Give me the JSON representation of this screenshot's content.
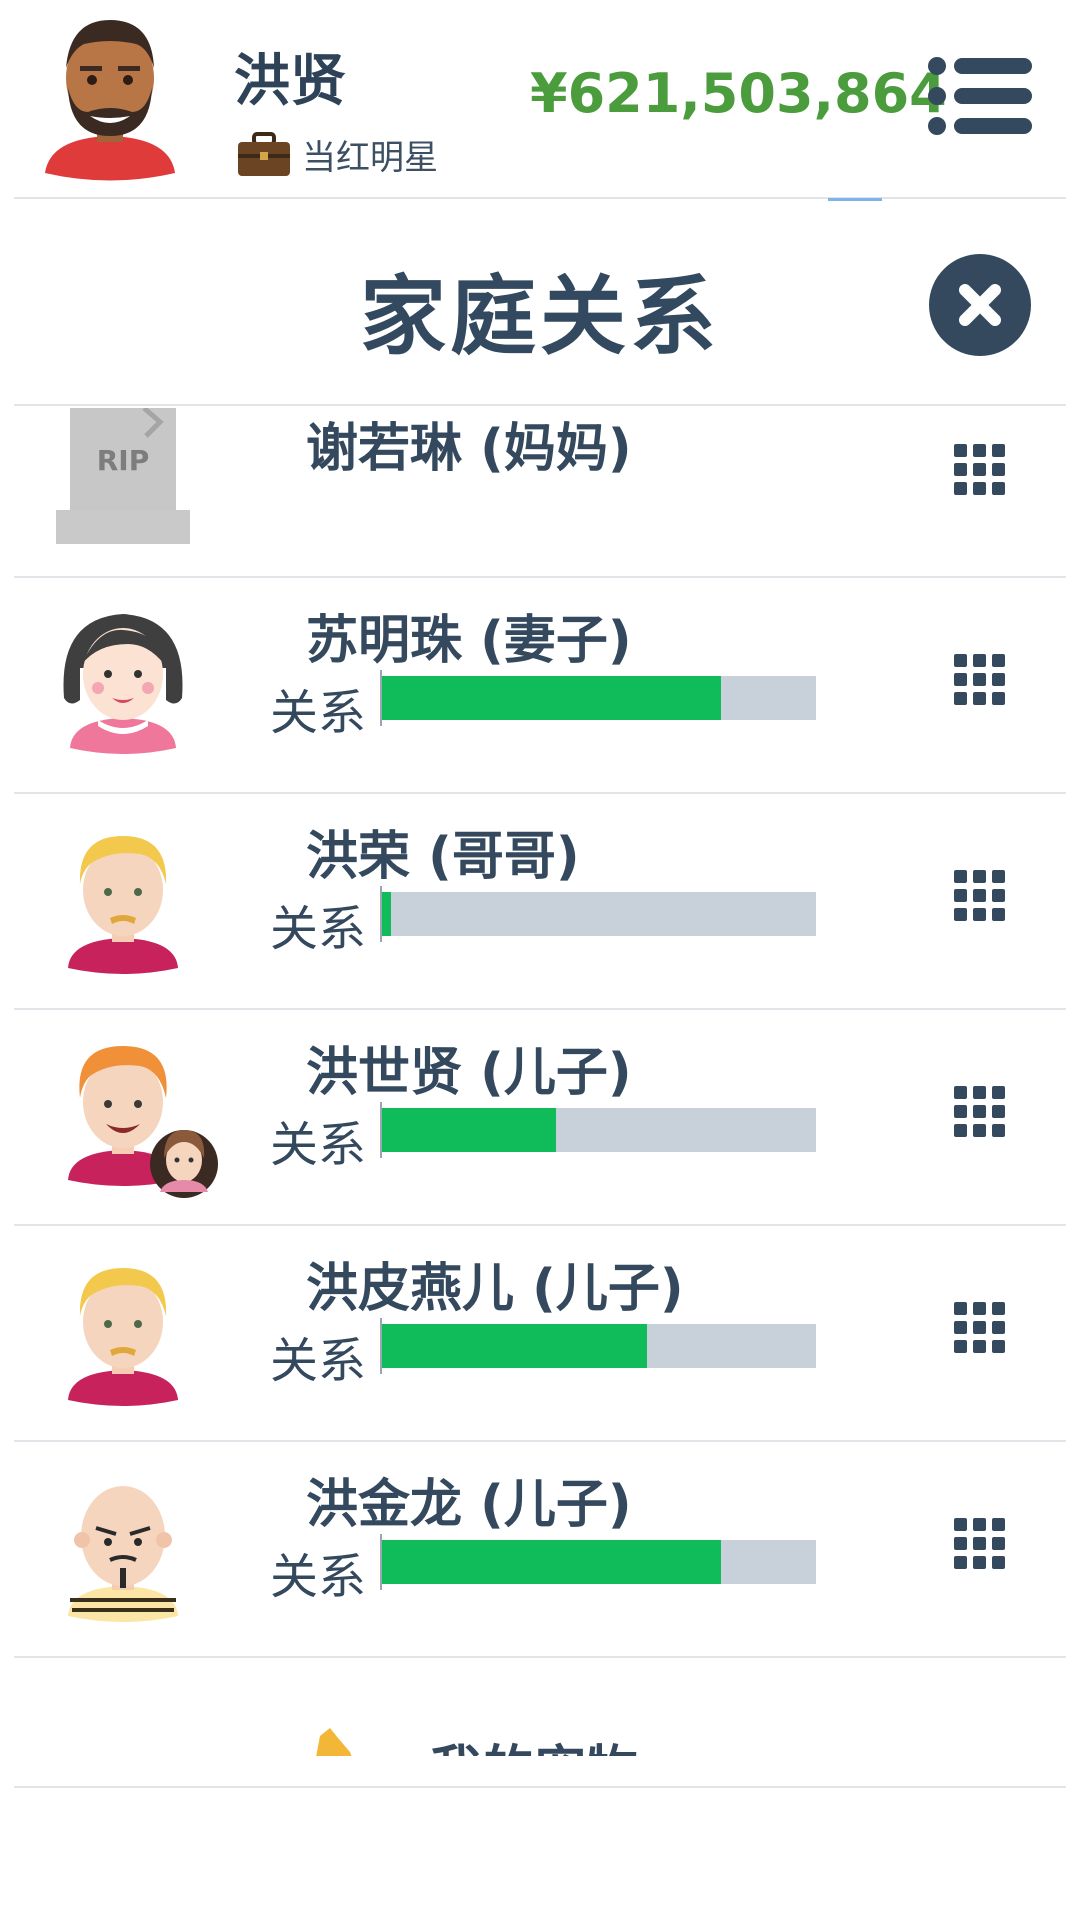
{
  "header": {
    "player_name": "洪贤",
    "job_title": "当红明星",
    "money": "¥621,503,864"
  },
  "page": {
    "title": "家庭关系"
  },
  "relations": [
    {
      "name": "谢若琳 (妈妈)",
      "deceased": true,
      "tombstone_text": "RIP"
    },
    {
      "name": "苏明珠 (妻子)",
      "bar_label": "关系",
      "relationship": 0.78
    },
    {
      "name": "洪荣 (哥哥)",
      "bar_label": "关系",
      "relationship": 0.02
    },
    {
      "name": "洪世贤 (儿子)",
      "bar_label": "关系",
      "relationship": 0.4
    },
    {
      "name": "洪皮燕儿 (儿子)",
      "bar_label": "关系",
      "relationship": 0.61
    },
    {
      "name": "洪金龙 (儿子)",
      "bar_label": "关系",
      "relationship": 0.78
    }
  ],
  "bottom_item": {
    "label": "我的宠物"
  },
  "colors": {
    "bar_fill": "#10bb5a",
    "bar_track": "#c8d1d9",
    "money": "#4a9c3c",
    "primary": "#34495e"
  },
  "icons": {
    "menu": "menu-list-icon",
    "close": "close-icon",
    "row_action": "grid-dots-icon",
    "job": "briefcase-icon"
  }
}
